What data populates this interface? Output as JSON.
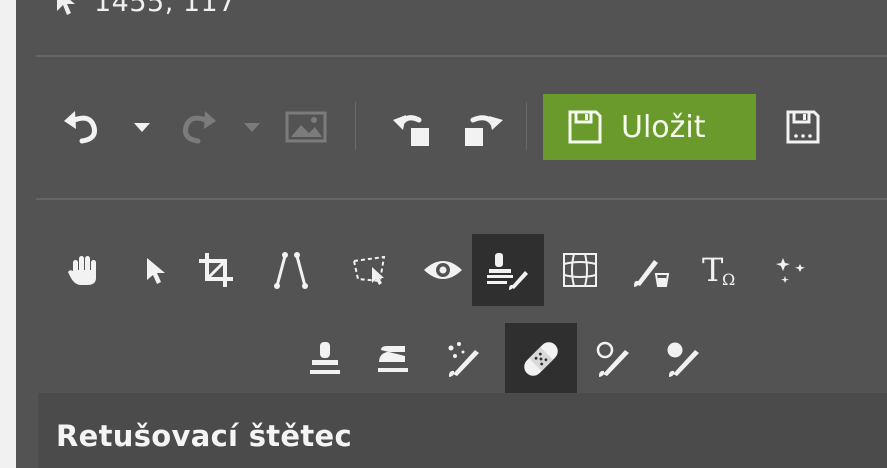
{
  "status": {
    "cursor_coords": "1455, 117",
    "pointer_icon": "mouse-pointer-icon"
  },
  "toolbar": {
    "undo_icon": "undo-icon",
    "redo_icon": "redo-icon",
    "image_icon": "image-icon",
    "rotate_left_icon": "rotate-left-icon",
    "rotate_right_icon": "rotate-right-icon",
    "save_label": "Uložit",
    "save_as_icon": "save-as-icon",
    "save_color": "#6a9a2c"
  },
  "tools": {
    "row1": [
      {
        "icon": "hand-icon",
        "active": false
      },
      {
        "icon": "arrow-pointer-icon",
        "active": false
      },
      {
        "icon": "crop-icon",
        "active": false
      },
      {
        "icon": "straighten-icon",
        "active": false
      },
      {
        "icon": "perspective-icon",
        "active": false
      },
      {
        "icon": "red-eye-icon",
        "active": false
      },
      {
        "icon": "retouch-tools-icon",
        "active": true
      },
      {
        "icon": "warp-grid-icon",
        "active": false
      },
      {
        "icon": "paint-bucket-brush-icon",
        "active": false
      },
      {
        "icon": "text-icon",
        "active": false
      },
      {
        "icon": "effects-icon",
        "active": false
      }
    ],
    "row2": [
      {
        "icon": "clone-stamp-icon",
        "active": false
      },
      {
        "icon": "iron-icon",
        "active": false
      },
      {
        "icon": "sparkle-brush-icon",
        "active": false
      },
      {
        "icon": "bandage-icon",
        "active": true
      },
      {
        "icon": "lighten-brush-icon",
        "active": false
      },
      {
        "icon": "darken-brush-icon",
        "active": false
      }
    ]
  },
  "panel": {
    "title": "Retušovací štětec"
  }
}
